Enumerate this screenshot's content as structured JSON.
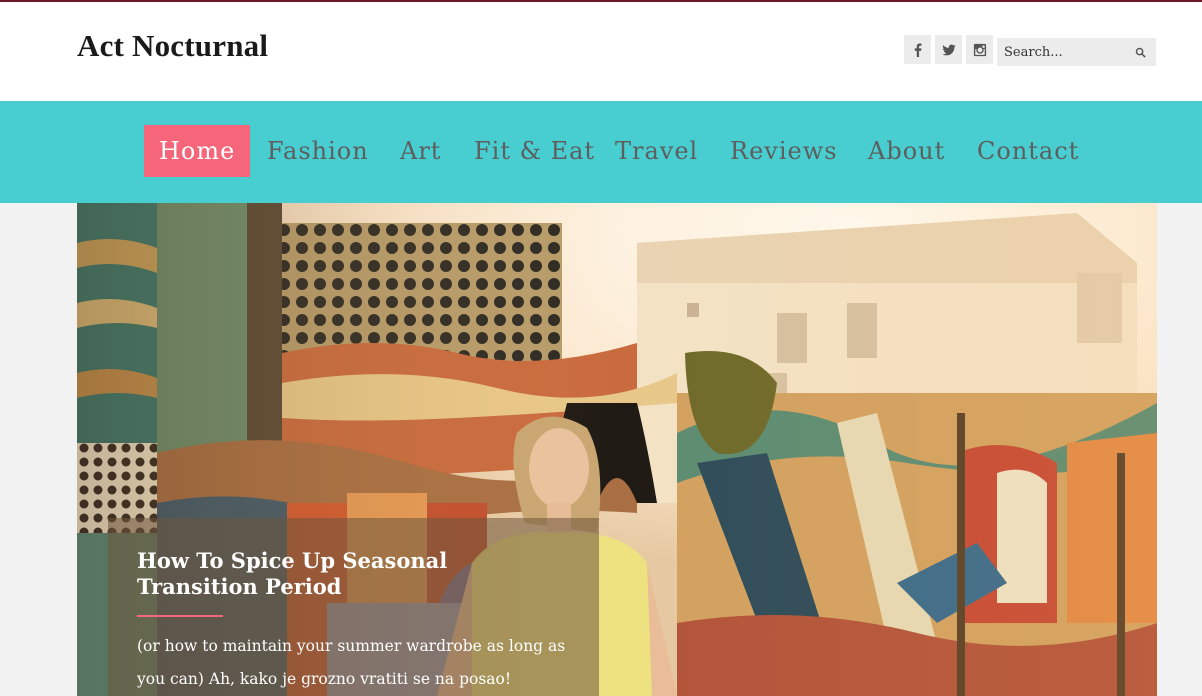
{
  "site": {
    "logo": "Act Nocturnal"
  },
  "header": {
    "social": [
      {
        "name": "facebook-icon"
      },
      {
        "name": "twitter-icon"
      },
      {
        "name": "instagram-icon"
      }
    ],
    "search": {
      "placeholder": "Search...",
      "icon": "search-icon"
    }
  },
  "nav": {
    "items": [
      {
        "label": "Home",
        "active": true
      },
      {
        "label": "Fashion"
      },
      {
        "label": "Art"
      },
      {
        "label": "Fit & Eat"
      },
      {
        "label": "Travel"
      },
      {
        "label": "Reviews"
      },
      {
        "label": "About"
      },
      {
        "label": "Contact"
      }
    ]
  },
  "featured": {
    "title": "How To Spice Up Seasonal Transition Period",
    "excerpt": "(or how to maintain your summer wardrobe as long as you can) Ah, kako je grozno vratiti se na posao!"
  },
  "colors": {
    "nav_bg": "#48cdd0",
    "accent": "#f6667b",
    "topline": "#6b1a2a"
  }
}
